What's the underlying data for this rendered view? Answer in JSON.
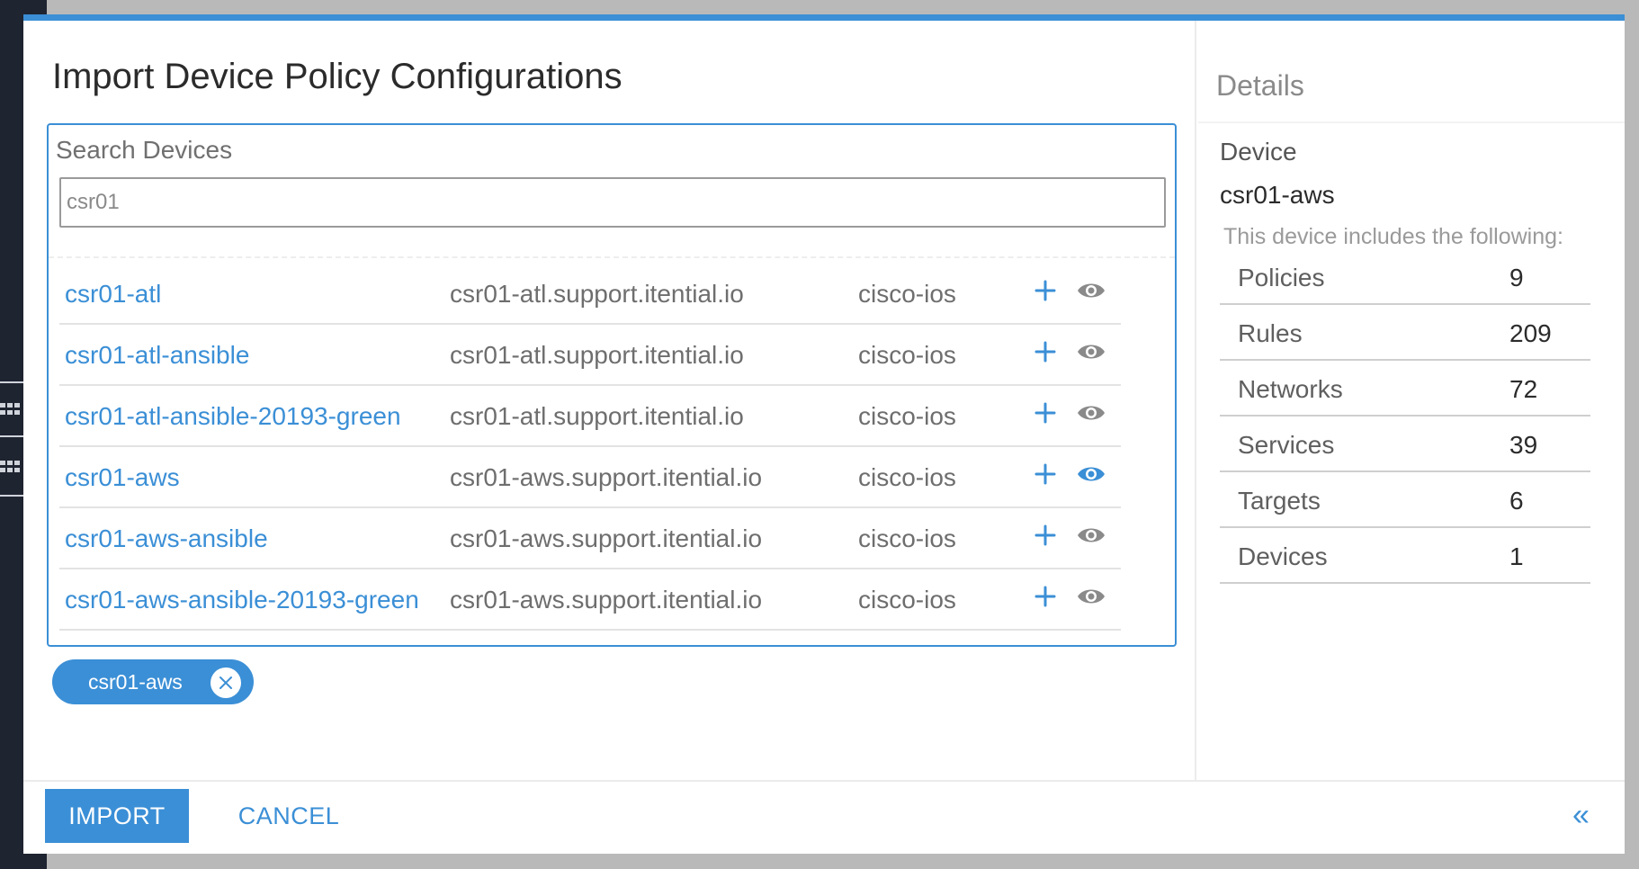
{
  "modal": {
    "title": "Import Device Policy Configurations"
  },
  "search": {
    "label": "Search Devices",
    "value": "csr01"
  },
  "devices": [
    {
      "name": "csr01-atl",
      "host": "csr01-atl.support.itential.io",
      "os": "cisco-ios",
      "viewing": false
    },
    {
      "name": "csr01-atl-ansible",
      "host": "csr01-atl.support.itential.io",
      "os": "cisco-ios",
      "viewing": false
    },
    {
      "name": "csr01-atl-ansible-20193-green",
      "host": "csr01-atl.support.itential.io",
      "os": "cisco-ios",
      "viewing": false
    },
    {
      "name": "csr01-aws",
      "host": "csr01-aws.support.itential.io",
      "os": "cisco-ios",
      "viewing": true
    },
    {
      "name": "csr01-aws-ansible",
      "host": "csr01-aws.support.itential.io",
      "os": "cisco-ios",
      "viewing": false
    },
    {
      "name": "csr01-aws-ansible-20193-green",
      "host": "csr01-aws.support.itential.io",
      "os": "cisco-ios",
      "viewing": false
    }
  ],
  "selected_chips": [
    {
      "label": "csr01-aws"
    }
  ],
  "details": {
    "title": "Details",
    "device_label": "Device",
    "device_name": "csr01-aws",
    "includes_text": "This device includes the following:",
    "rows": [
      {
        "key": "Policies",
        "value": "9"
      },
      {
        "key": "Rules",
        "value": "209"
      },
      {
        "key": "Networks",
        "value": "72"
      },
      {
        "key": "Services",
        "value": "39"
      },
      {
        "key": "Targets",
        "value": "6"
      },
      {
        "key": "Devices",
        "value": "1"
      }
    ]
  },
  "footer": {
    "import_label": "IMPORT",
    "cancel_label": "CANCEL",
    "collapse_label": "«"
  },
  "colors": {
    "accent": "#3b8fd6",
    "eye_inactive": "#8a8a8a",
    "sidebar_bg": "#1f2431"
  },
  "icons": {
    "add": "plus-icon",
    "view": "eye-icon",
    "remove_chip": "close-icon",
    "collapse": "double-chevron-left-icon",
    "app_grid": "grid-icon"
  }
}
